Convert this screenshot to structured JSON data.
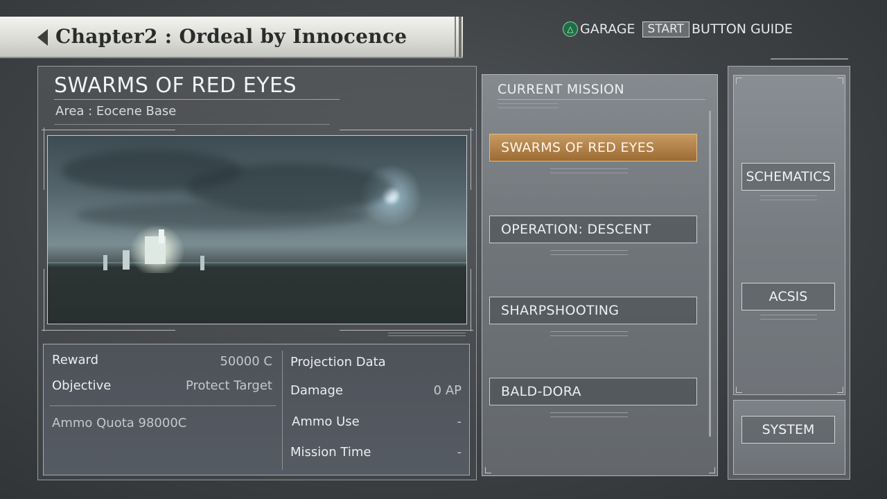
{
  "header": {
    "chapter_title": "Chapter2 : Ordeal by Innocence",
    "garage_label": "GARAGE",
    "start_label": "START",
    "button_guide_label": "BUTTON GUIDE"
  },
  "mission": {
    "name": "SWARMS OF RED EYES",
    "area": "Area : Eocene Base"
  },
  "stats": {
    "reward_label": "Reward",
    "reward_value": "50000 C",
    "objective_label": "Objective",
    "objective_value": "Protect Target",
    "ammo_quota": "Ammo Quota 98000C",
    "projection_label": "Projection Data",
    "damage_label": "Damage",
    "damage_value": "0 AP",
    "ammo_use_label": "Ammo Use",
    "ammo_use_value": "-",
    "mission_time_label": "Mission Time",
    "mission_time_value": "-"
  },
  "mission_list": {
    "header": "CURRENT MISSION",
    "items": [
      {
        "label": "SWARMS OF RED EYES",
        "selected": true
      },
      {
        "label": "OPERATION: DESCENT",
        "selected": false
      },
      {
        "label": "SHARPSHOOTING",
        "selected": false
      },
      {
        "label": "BALD-DORA",
        "selected": false
      }
    ]
  },
  "side_menu": {
    "schematics": "SCHEMATICS",
    "acsis": "ACSIS",
    "system": "SYSTEM"
  },
  "colors": {
    "selected_accent": "#b8844a",
    "garage_icon": "#1f6d45"
  },
  "icons": {
    "back": "left-arrow-icon",
    "garage": "triangle-button-icon"
  }
}
